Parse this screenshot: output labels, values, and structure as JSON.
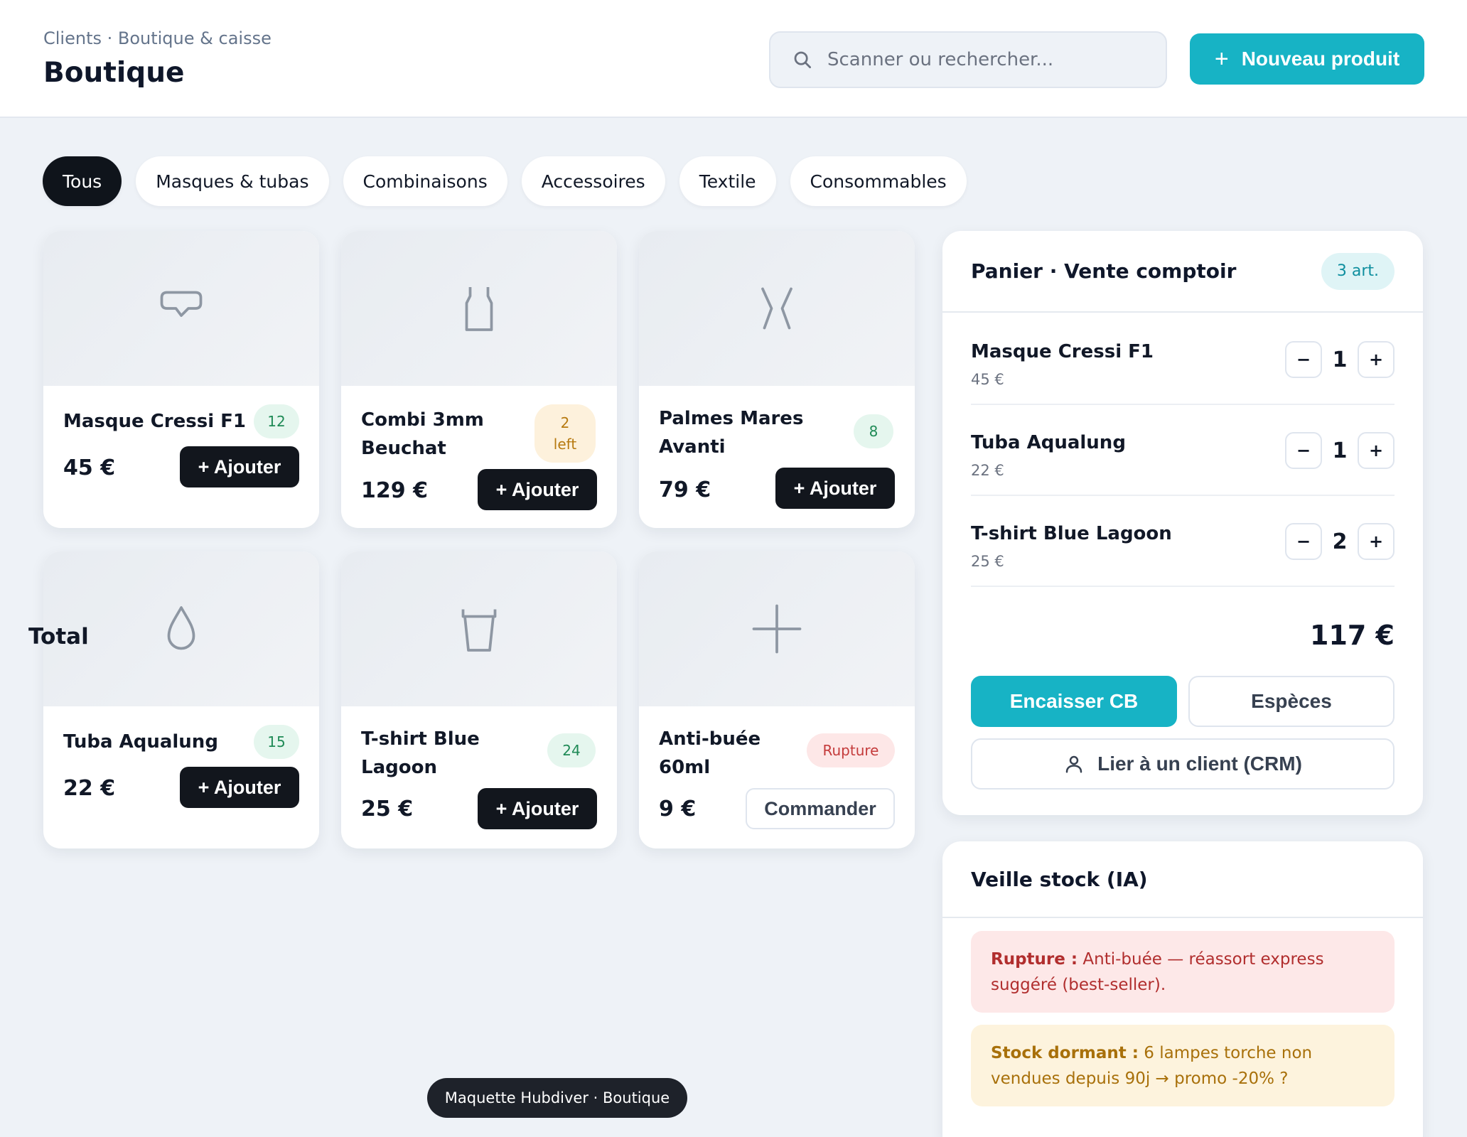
{
  "header": {
    "breadcrumb": "Clients · Boutique & caisse",
    "title": "Boutique",
    "search_placeholder": "Scanner ou rechercher...",
    "new_product_label": "Nouveau produit",
    "new_product_icon": "plus-icon",
    "accent_color": "#17b3c5"
  },
  "filters": [
    "Tous",
    "Masques & tubas",
    "Combinaisons",
    "Accessoires",
    "Textile",
    "Consommables"
  ],
  "active_filter": "Tous",
  "products": [
    {
      "name": "Masque Cressi F1",
      "stock": "12",
      "price": "45 €",
      "action": "+ Ajouter",
      "icon": "mask-icon"
    },
    {
      "name": "Combi 3mm Beuchat",
      "stock": "2 left",
      "price": "129 €",
      "action": "+ Ajouter",
      "icon": "wetsuit-icon"
    },
    {
      "name": "Palmes Mares Avanti",
      "stock": "8",
      "price": "79 €",
      "action": "+ Ajouter",
      "icon": "fins-icon"
    },
    {
      "name": "Tuba Aqualung",
      "stock": "15",
      "price": "22 €",
      "action": "+ Ajouter",
      "icon": "drop-icon"
    },
    {
      "name": "T-shirt Blue Lagoon",
      "stock": "24",
      "price": "25 €",
      "action": "+ Ajouter",
      "icon": "cup-icon"
    },
    {
      "name": "Anti-buée 60ml",
      "stock": "Rupture",
      "price": "9 €",
      "action": "Commander",
      "icon": "plus-icon"
    }
  ],
  "cart": {
    "title": "Panier · Vente comptoir",
    "count": "3 art.",
    "items": [
      {
        "name": "Masque Cressi F1",
        "price": "45 €",
        "qty": "1"
      },
      {
        "name": "Tuba Aqualung",
        "price": "22 €",
        "qty": "1"
      },
      {
        "name": "T-shirt Blue Lagoon",
        "price": "25 €",
        "qty": "2"
      }
    ],
    "minus": "−",
    "plus": "+",
    "total_label": "Total",
    "total_value": "117 €",
    "pay_card": "Encaisser CB",
    "pay_cash": "Espèces",
    "link_client": "Lier à un client (CRM)"
  },
  "stock_watch": {
    "title": "Veille stock (IA)",
    "alerts": [
      {
        "label": "Rupture :",
        "text": " Anti-buée — réassort express suggéré (best-seller).",
        "color": "#b12e2e"
      },
      {
        "label": "Stock dormant :",
        "text": " 6 lampes torche non vendues depuis 90j → promo -20% ?",
        "color": "#a8700a"
      }
    ]
  },
  "footer": "Maquette Hubdiver · Boutique"
}
